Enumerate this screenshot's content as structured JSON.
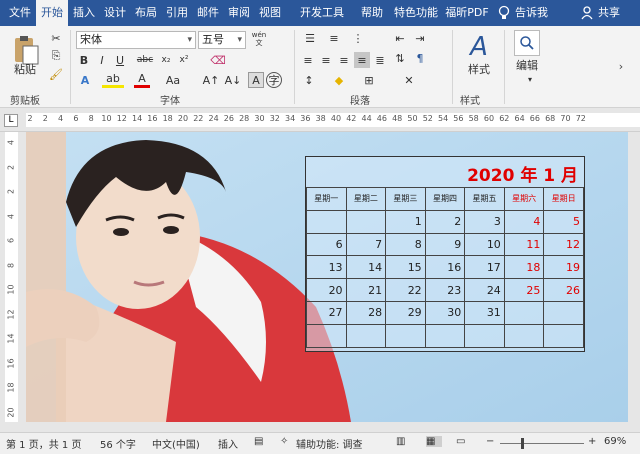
{
  "tabs": [
    {
      "label": "文件",
      "active": false
    },
    {
      "label": "开始",
      "active": true
    },
    {
      "label": "插入",
      "active": false
    },
    {
      "label": "设计",
      "active": false
    },
    {
      "label": "布局",
      "active": false
    },
    {
      "label": "引用",
      "active": false
    },
    {
      "label": "邮件",
      "active": false
    },
    {
      "label": "审阅",
      "active": false
    },
    {
      "label": "视图",
      "active": false
    },
    {
      "label": "开发工具",
      "active": false
    },
    {
      "label": "帮助",
      "active": false
    },
    {
      "label": "特色功能",
      "active": false
    },
    {
      "label": "福昕PDF",
      "active": false
    }
  ],
  "tellme": "告诉我",
  "share": "共享",
  "ribbon": {
    "paste": "粘贴",
    "font_name": "宋体",
    "font_size": "五号",
    "wen": "wén",
    "styles": "样式",
    "editing": "编辑",
    "groups": {
      "clipboard": "剪贴板",
      "font": "字体",
      "paragraph": "段落",
      "styles": "样式"
    }
  },
  "ruler": {
    "h": [
      "2",
      "2",
      "4",
      "6",
      "8",
      "10",
      "12",
      "14",
      "16",
      "18",
      "20",
      "22",
      "24",
      "26",
      "28",
      "30",
      "32",
      "34",
      "36",
      "38",
      "40",
      "42",
      "44",
      "46",
      "48",
      "50",
      "52",
      "54",
      "56",
      "58",
      "60",
      "62",
      "64",
      "66",
      "68",
      "70",
      "72"
    ],
    "v": [
      "4",
      "2",
      "2",
      "4",
      "6",
      "8",
      "10",
      "12",
      "14",
      "16",
      "18",
      "20"
    ]
  },
  "calendar": {
    "title": "2020 年 1 月",
    "headers": [
      "星期一",
      "星期二",
      "星期三",
      "星期四",
      "星期五",
      "星期六",
      "星期日"
    ],
    "rows": [
      [
        "",
        "",
        "1",
        "2",
        "3",
        "4",
        "5"
      ],
      [
        "6",
        "7",
        "8",
        "9",
        "10",
        "11",
        "12"
      ],
      [
        "13",
        "14",
        "15",
        "16",
        "17",
        "18",
        "19"
      ],
      [
        "20",
        "21",
        "22",
        "23",
        "24",
        "25",
        "26"
      ],
      [
        "27",
        "28",
        "29",
        "30",
        "31",
        "",
        ""
      ],
      [
        "",
        "",
        "",
        "",
        "",
        "",
        ""
      ]
    ]
  },
  "status": {
    "page": "第 1 页，共 1 页",
    "words": "56 个字",
    "lang": "中文(中国)",
    "insert": "插入",
    "accessibility": "辅助功能: 调查",
    "zoom": "69%"
  },
  "colors": {
    "accent": "#2b579a",
    "calendar_red": "#e00000",
    "photo_bg": "#b6d6ee",
    "jacket": "#d9383c"
  }
}
